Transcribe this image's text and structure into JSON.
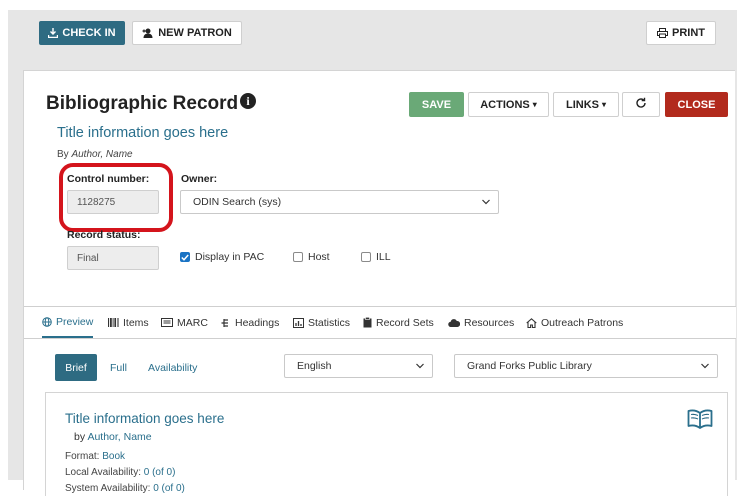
{
  "header": {
    "check_in_label": "CHECK IN",
    "new_patron_label": "NEW PATRON",
    "print_label": "PRINT"
  },
  "record": {
    "heading": "Bibliographic Record",
    "title": "Title information goes here",
    "by_prefix": "By",
    "author": "Author, Name"
  },
  "toolbar": {
    "save_label": "SAVE",
    "actions_label": "ACTIONS",
    "links_label": "LINKS",
    "close_label": "CLOSE"
  },
  "form": {
    "control_number_label": "Control number:",
    "control_number_value": "1128275",
    "owner_label": "Owner:",
    "owner_value": "ODIN Search (sys)",
    "record_status_label": "Record status:",
    "record_status_value": "Final",
    "display_in_pac_label": "Display in PAC",
    "display_in_pac_checked": true,
    "host_label": "Host",
    "host_checked": false,
    "ill_label": "ILL",
    "ill_checked": false
  },
  "tabs": [
    {
      "label": "Preview",
      "icon": "globe-icon",
      "active": true
    },
    {
      "label": "Items",
      "icon": "barcode-icon"
    },
    {
      "label": "MARC",
      "icon": "list-icon"
    },
    {
      "label": "Headings",
      "icon": "tree-icon"
    },
    {
      "label": "Statistics",
      "icon": "chart-icon"
    },
    {
      "label": "Record Sets",
      "icon": "clipboard-icon"
    },
    {
      "label": "Resources",
      "icon": "cloud-icon"
    },
    {
      "label": "Outreach Patrons",
      "icon": "home-icon"
    }
  ],
  "preview": {
    "brief_label": "Brief",
    "full_label": "Full",
    "availability_label": "Availability",
    "language_value": "English",
    "library_value": "Grand Forks Public Library"
  },
  "card": {
    "title": "Title information goes here",
    "by_prefix": "by",
    "author": "Author, Name",
    "format_label": "Format:",
    "format_value": "Book",
    "local_label": "Local Availability:",
    "local_value": "0 (of 0)",
    "system_label": "System Availability:",
    "system_value": "0 (of 0)"
  },
  "colors": {
    "primary": "#2e6b82",
    "save": "#6aa977",
    "close": "#b22a1d",
    "highlight": "#d4141c",
    "link": "#2a6f8c"
  }
}
